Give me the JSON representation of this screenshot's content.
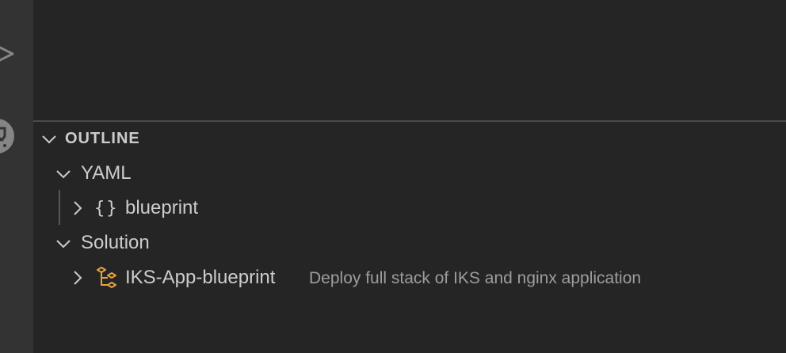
{
  "outline": {
    "title": "OUTLINE"
  },
  "tree": {
    "yaml": {
      "label": "YAML",
      "children": [
        {
          "icon": "braces-icon",
          "label": "blueprint"
        }
      ]
    },
    "solution": {
      "label": "Solution",
      "children": [
        {
          "icon": "type-hierarchy-icon",
          "label": "IKS-App-blueprint",
          "description": "Deploy full stack of IKS and nginx application"
        }
      ]
    }
  },
  "colors": {
    "activity_bar": "#333333",
    "sidebar": "#252526",
    "text": "#cccccc",
    "description": "#9d9d9d",
    "icon_accent": "#e8a33d"
  }
}
